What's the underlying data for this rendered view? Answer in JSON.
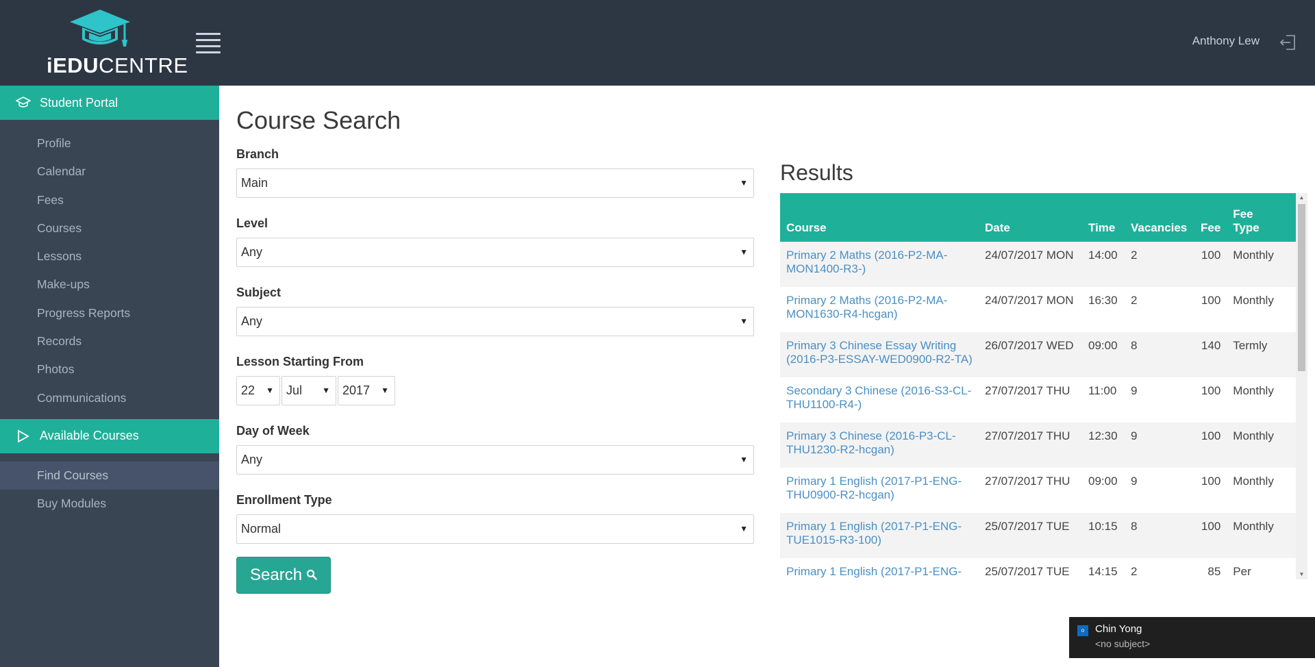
{
  "app": {
    "logo_text_bold": "iEDU",
    "logo_text_regular": "CENTRE",
    "user_name": "Anthony Lew"
  },
  "sidebar": {
    "section1_title": "Student Portal",
    "section1_items": [
      "Profile",
      "Calendar",
      "Fees",
      "Courses",
      "Lessons",
      "Make-ups",
      "Progress Reports",
      "Records",
      "Photos",
      "Communications"
    ],
    "section2_title": "Available Courses",
    "section2_items": [
      "Find Courses",
      "Buy Modules"
    ],
    "active_item": "Find Courses"
  },
  "form": {
    "page_title": "Course Search",
    "branch_label": "Branch",
    "branch_value": "Main",
    "level_label": "Level",
    "level_value": "Any",
    "subject_label": "Subject",
    "subject_value": "Any",
    "date_label": "Lesson Starting From",
    "date_day": "22",
    "date_month": "Jul",
    "date_year": "2017",
    "dow_label": "Day of Week",
    "dow_value": "Any",
    "enroll_label": "Enrollment Type",
    "enroll_value": "Normal",
    "search_label": "Search"
  },
  "results": {
    "title": "Results",
    "columns": [
      "Course",
      "Date",
      "Time",
      "Vacancies",
      "Fee",
      "Fee Type"
    ],
    "fee_type_header_line1": "Fee",
    "fee_type_header_line2": "Type",
    "rows": [
      {
        "course": "Primary 2 Maths (2016-P2-MA-MON1400-R3-)",
        "date": "24/07/2017 MON",
        "time": "14:00",
        "vacancies": "2",
        "fee": "100",
        "fee_type": "Monthly"
      },
      {
        "course": "Primary 2 Maths (2016-P2-MA-MON1630-R4-hcgan)",
        "date": "24/07/2017 MON",
        "time": "16:30",
        "vacancies": "2",
        "fee": "100",
        "fee_type": "Monthly"
      },
      {
        "course": "Primary 3 Chinese Essay Writing (2016-P3-ESSAY-WED0900-R2-TA)",
        "date": "26/07/2017 WED",
        "time": "09:00",
        "vacancies": "8",
        "fee": "140",
        "fee_type": "Termly"
      },
      {
        "course": "Secondary 3 Chinese (2016-S3-CL-THU1100-R4-)",
        "date": "27/07/2017 THU",
        "time": "11:00",
        "vacancies": "9",
        "fee": "100",
        "fee_type": "Monthly"
      },
      {
        "course": "Primary 3 Chinese (2016-P3-CL-THU1230-R2-hcgan)",
        "date": "27/07/2017 THU",
        "time": "12:30",
        "vacancies": "9",
        "fee": "100",
        "fee_type": "Monthly"
      },
      {
        "course": "Primary 1 English (2017-P1-ENG-THU0900-R2-hcgan)",
        "date": "27/07/2017 THU",
        "time": "09:00",
        "vacancies": "9",
        "fee": "100",
        "fee_type": "Monthly"
      },
      {
        "course": "Primary 1 English (2017-P1-ENG-TUE1015-R3-100)",
        "date": "25/07/2017 TUE",
        "time": "10:15",
        "vacancies": "8",
        "fee": "100",
        "fee_type": "Monthly"
      },
      {
        "course": "Primary 1 English (2017-P1-ENG-",
        "date": "25/07/2017 TUE",
        "time": "14:15",
        "vacancies": "2",
        "fee": "85",
        "fee_type": "Per"
      }
    ]
  },
  "notification": {
    "sender": "Chin Yong",
    "subject": "<no subject>",
    "app_icon": "outlook-icon"
  },
  "icons": {
    "logo": "graduation-cap-icon",
    "menu": "hamburger-menu-icon",
    "logout": "logout-icon",
    "section1": "graduation-cap-icon",
    "section2": "play-triangle-icon",
    "search": "magnifier-icon"
  },
  "colors": {
    "header_bg": "#2d3744",
    "sidebar_bg": "#3a4554",
    "accent": "#1fb09a",
    "button": "#27a694",
    "link": "#4a8fc5"
  }
}
